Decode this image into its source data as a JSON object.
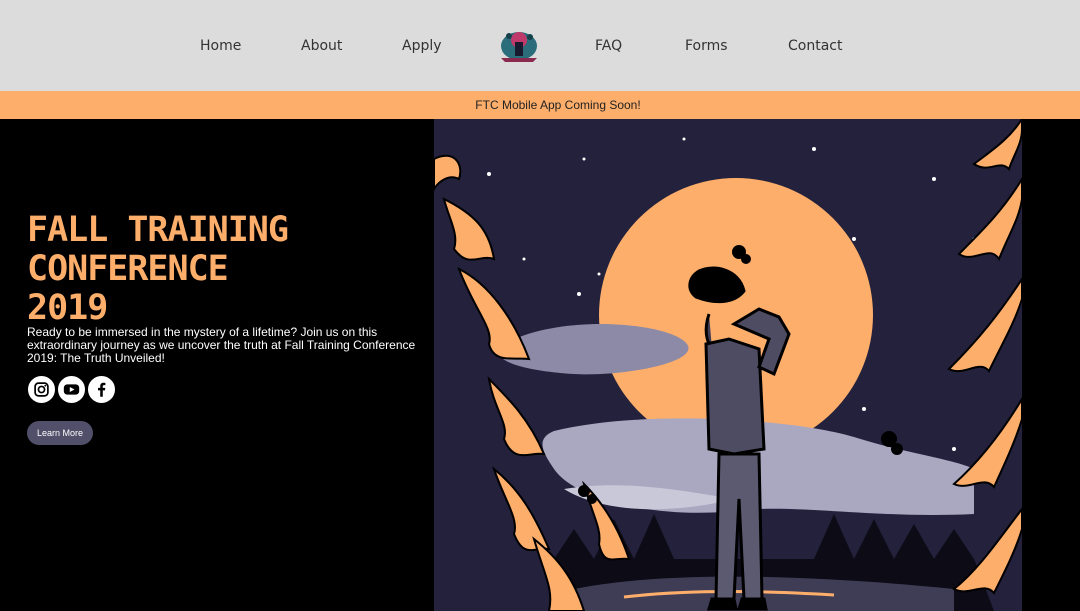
{
  "nav": {
    "home": "Home",
    "about": "About",
    "apply": "Apply",
    "faq": "FAQ",
    "forms": "Forms",
    "contact": "Contact",
    "logo_icon": "ftc-logo-icon"
  },
  "banner": {
    "text": "FTC Mobile App Coming Soon!"
  },
  "hero": {
    "title_line1": "FALL TRAINING",
    "title_line2": "CONFERENCE",
    "title_line3": "2019",
    "description": "Ready to be immersed in the mystery of a lifetime? Join us on this extraordinary journey as we uncover the truth at Fall Training Conference 2019: The Truth Unveiled!",
    "learn_more": "Learn More"
  },
  "socials": [
    {
      "icon": "instagram-icon"
    },
    {
      "icon": "youtube-icon"
    },
    {
      "icon": "facebook-icon"
    }
  ],
  "colors": {
    "nav_bg": "#dcdcdc",
    "accent": "#fdae6b",
    "hero_bg": "#000000",
    "night_sky": "#23213b",
    "button": "#514f6a"
  }
}
